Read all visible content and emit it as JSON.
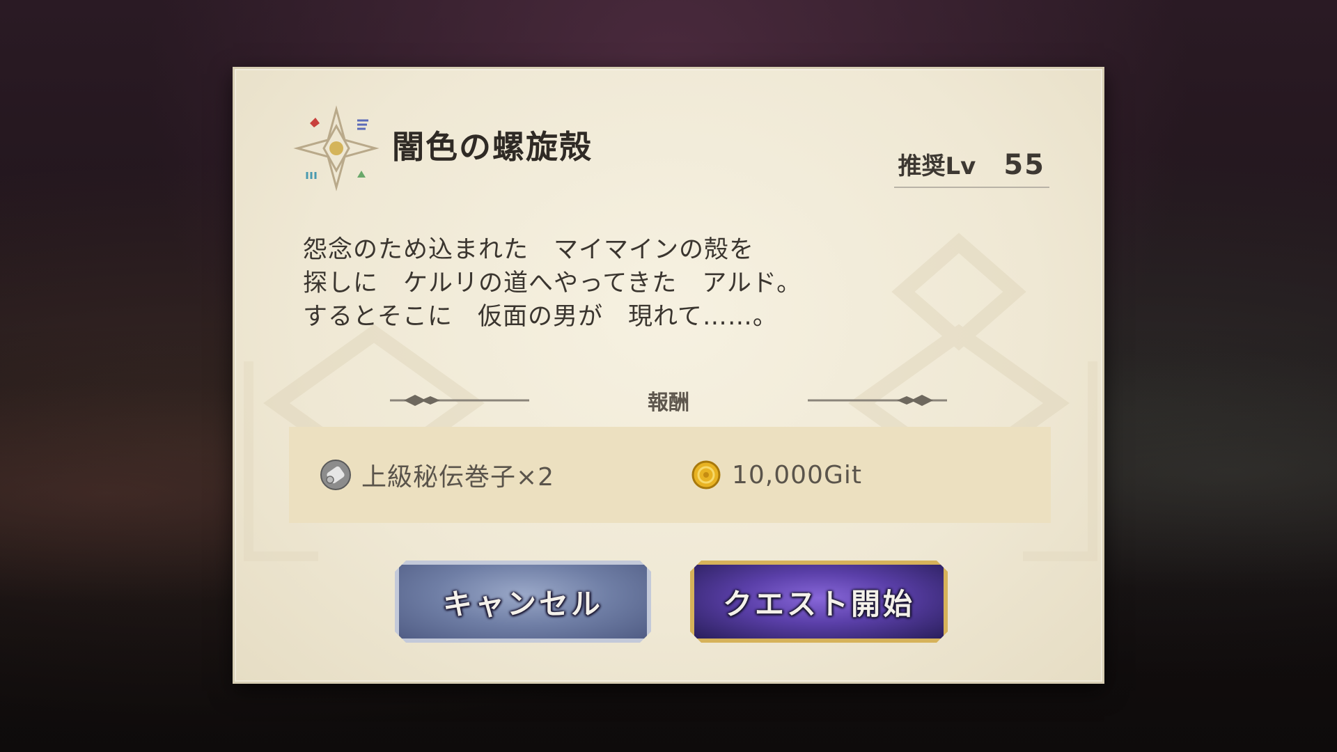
{
  "quest": {
    "title": "闇色の螺旋殻",
    "recommended_level_label": "推奨Lv",
    "recommended_level_value": "55",
    "description_lines": [
      "怨念のため込まれた　マイマインの殻を",
      "探しに　ケルリの道へやってきた　アルド。",
      "するとそこに　仮面の男が　現れて……。"
    ]
  },
  "rewards": {
    "header": "報酬",
    "items": [
      {
        "icon": "scroll-icon",
        "label": "上級秘伝巻子×2"
      },
      {
        "icon": "git-coin-icon",
        "label": "10,000Git"
      }
    ]
  },
  "buttons": {
    "cancel_label": "キャンセル",
    "start_label": "クエスト開始"
  },
  "colors": {
    "dialog_bg": "#f3eddb",
    "reward_box_bg": "#ece0c0",
    "cancel_button": "#6f7ea5",
    "start_button": "#5a3fa8",
    "start_border": "#d6b25a"
  }
}
